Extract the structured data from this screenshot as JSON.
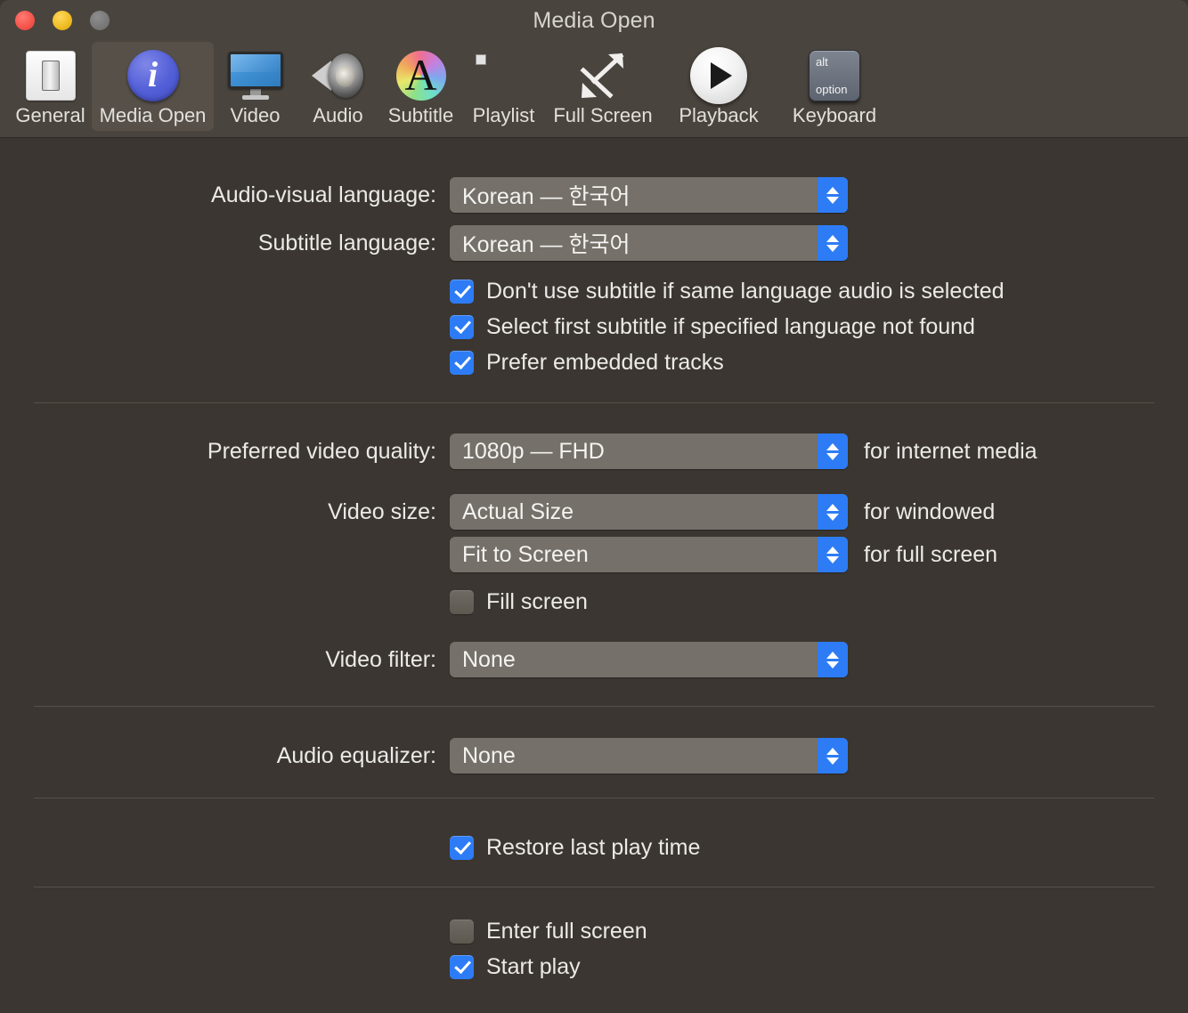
{
  "window": {
    "title": "Media Open",
    "traffic_lights": [
      {
        "name": "close",
        "color": "#f4534a"
      },
      {
        "name": "minimize",
        "color": "#efbb22"
      },
      {
        "name": "zoom",
        "color": "#787878"
      }
    ]
  },
  "toolbar": {
    "selected": "Media Open",
    "items": [
      {
        "label": "General",
        "icon": "switch-icon"
      },
      {
        "label": "Media Open",
        "icon": "info-icon"
      },
      {
        "label": "Video",
        "icon": "monitor-icon"
      },
      {
        "label": "Audio",
        "icon": "speaker-icon"
      },
      {
        "label": "Subtitle",
        "icon": "font-color-icon"
      },
      {
        "label": "Playlist",
        "icon": "list-icon"
      },
      {
        "label": "Full Screen",
        "icon": "expand-arrows-icon"
      },
      {
        "label": "Playback",
        "icon": "play-circle-icon"
      },
      {
        "label": "Keyboard",
        "icon": "option-key-icon"
      }
    ],
    "keyboard_icon": {
      "top": "alt",
      "bottom": "option"
    }
  },
  "settings": {
    "audio_visual_language": {
      "label": "Audio-visual language:",
      "value": "Korean — 한국어"
    },
    "subtitle_language": {
      "label": "Subtitle language:",
      "value": "Korean — 한국어"
    },
    "subtitle_checkboxes": [
      {
        "label": "Don't use subtitle if same language audio is selected",
        "checked": true
      },
      {
        "label": "Select first subtitle if specified language not found",
        "checked": true
      },
      {
        "label": "Prefer embedded tracks",
        "checked": true
      }
    ],
    "preferred_video_quality": {
      "label": "Preferred video quality:",
      "value": "1080p — FHD",
      "suffix": "for internet media"
    },
    "video_size": {
      "label": "Video size:",
      "windowed_value": "Actual Size",
      "windowed_suffix": "for windowed",
      "fullscreen_value": "Fit to Screen",
      "fullscreen_suffix": "for full screen"
    },
    "fill_screen": {
      "label": "Fill screen",
      "checked": false
    },
    "video_filter": {
      "label": "Video filter:",
      "value": "None"
    },
    "audio_equalizer": {
      "label": "Audio equalizer:",
      "value": "None"
    },
    "restore_last_play_time": {
      "label": "Restore last play time",
      "checked": true
    },
    "enter_full_screen": {
      "label": "Enter full screen",
      "checked": false
    },
    "start_play": {
      "label": "Start play",
      "checked": true
    }
  },
  "colors": {
    "accent": "#2d7cf6",
    "window_bg": "#3b3631",
    "toolbar_bg": "#4a443e",
    "popup_bg": "#757069",
    "text": "#eceae7"
  }
}
